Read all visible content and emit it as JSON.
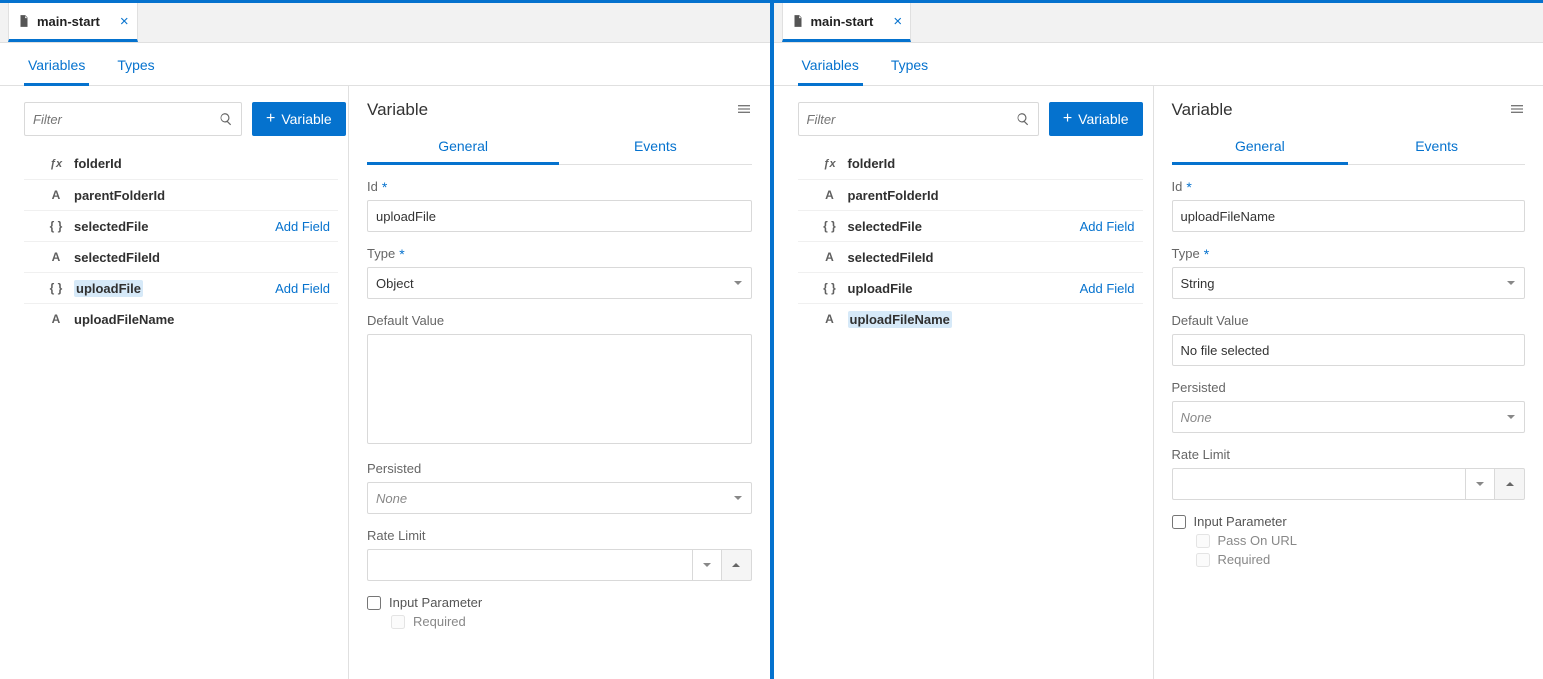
{
  "left": {
    "tab": {
      "title": "main-start"
    },
    "nav": {
      "variables": "Variables",
      "types": "Types"
    },
    "filter": {
      "placeholder": "Filter"
    },
    "add_btn": "Variable",
    "vars": [
      {
        "icon": "fx",
        "name": "folderId",
        "action": "",
        "selected": false
      },
      {
        "icon": "A",
        "name": "parentFolderId",
        "action": "",
        "selected": false
      },
      {
        "icon": "{}",
        "name": "selectedFile",
        "action": "Add Field",
        "selected": false
      },
      {
        "icon": "A",
        "name": "selectedFileId",
        "action": "",
        "selected": false
      },
      {
        "icon": "{}",
        "name": "uploadFile",
        "action": "Add Field",
        "selected": true
      },
      {
        "icon": "A",
        "name": "uploadFileName",
        "action": "",
        "selected": false
      }
    ],
    "panel": {
      "title": "Variable",
      "tabs": {
        "general": "General",
        "events": "Events"
      },
      "labels": {
        "id": "Id",
        "type": "Type",
        "default": "Default Value",
        "persisted": "Persisted",
        "rate": "Rate Limit",
        "input_param": "Input Parameter",
        "required": "Required"
      },
      "values": {
        "id": "uploadFile",
        "type": "Object",
        "default": "",
        "persisted": "None"
      }
    }
  },
  "right": {
    "tab": {
      "title": "main-start"
    },
    "nav": {
      "variables": "Variables",
      "types": "Types"
    },
    "filter": {
      "placeholder": "Filter"
    },
    "add_btn": "Variable",
    "vars": [
      {
        "icon": "fx",
        "name": "folderId",
        "action": "",
        "selected": false
      },
      {
        "icon": "A",
        "name": "parentFolderId",
        "action": "",
        "selected": false
      },
      {
        "icon": "{}",
        "name": "selectedFile",
        "action": "Add Field",
        "selected": false
      },
      {
        "icon": "A",
        "name": "selectedFileId",
        "action": "",
        "selected": false
      },
      {
        "icon": "{}",
        "name": "uploadFile",
        "action": "Add Field",
        "selected": false
      },
      {
        "icon": "A",
        "name": "uploadFileName",
        "action": "",
        "selected": true
      }
    ],
    "panel": {
      "title": "Variable",
      "tabs": {
        "general": "General",
        "events": "Events"
      },
      "labels": {
        "id": "Id",
        "type": "Type",
        "default": "Default Value",
        "persisted": "Persisted",
        "rate": "Rate Limit",
        "input_param": "Input Parameter",
        "pass_url": "Pass On URL",
        "required": "Required"
      },
      "values": {
        "id": "uploadFileName",
        "type": "String",
        "default": "No file selected",
        "persisted": "None"
      }
    }
  }
}
